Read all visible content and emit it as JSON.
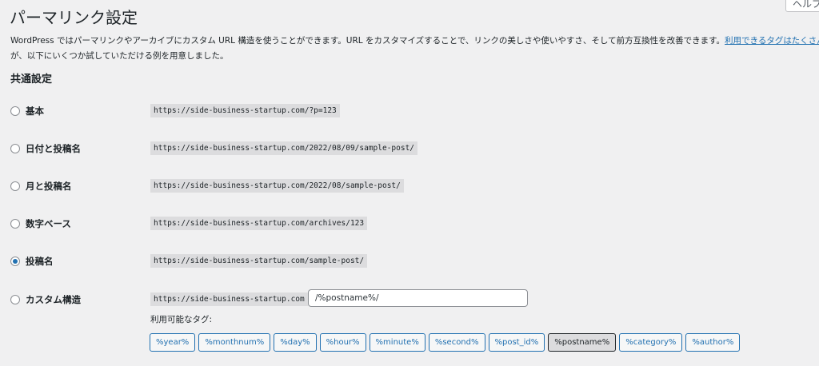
{
  "help_tab": "ヘルプ",
  "page_title": "パーマリンク設定",
  "description": {
    "line1": "WordPress ではパーマリンクやアーカイブにカスタム URL 構造を使うことができます。URL をカスタマイズすることで、リンクの美しさや使いやすさ、そして前方互換性を改善できます。",
    "link": "利用できるタグはたくさんあります",
    "line2": "が、以下にいくつか試していただける例を用意しました。"
  },
  "section_heading": "共通設定",
  "options": [
    {
      "label": "基本",
      "example": "https://side-business-startup.com/?p=123",
      "selected": false
    },
    {
      "label": "日付と投稿名",
      "example": "https://side-business-startup.com/2022/08/09/sample-post/",
      "selected": false
    },
    {
      "label": "月と投稿名",
      "example": "https://side-business-startup.com/2022/08/sample-post/",
      "selected": false
    },
    {
      "label": "数字ベース",
      "example": "https://side-business-startup.com/archives/123",
      "selected": false
    },
    {
      "label": "投稿名",
      "example": "https://side-business-startup.com/sample-post/",
      "selected": true
    },
    {
      "label": "カスタム構造",
      "example": "https://side-business-startup.com",
      "selected": false
    }
  ],
  "custom_structure_value": "/%postname%/",
  "available_tags_label": "利用可能なタグ:",
  "tags": [
    "%year%",
    "%monthnum%",
    "%day%",
    "%hour%",
    "%minute%",
    "%second%",
    "%post_id%",
    "%postname%",
    "%category%",
    "%author%"
  ],
  "active_tag": "%postname%",
  "colors": {
    "link": "#2271b1",
    "background": "#f0f0f1",
    "code_bg": "#dcdcde"
  }
}
